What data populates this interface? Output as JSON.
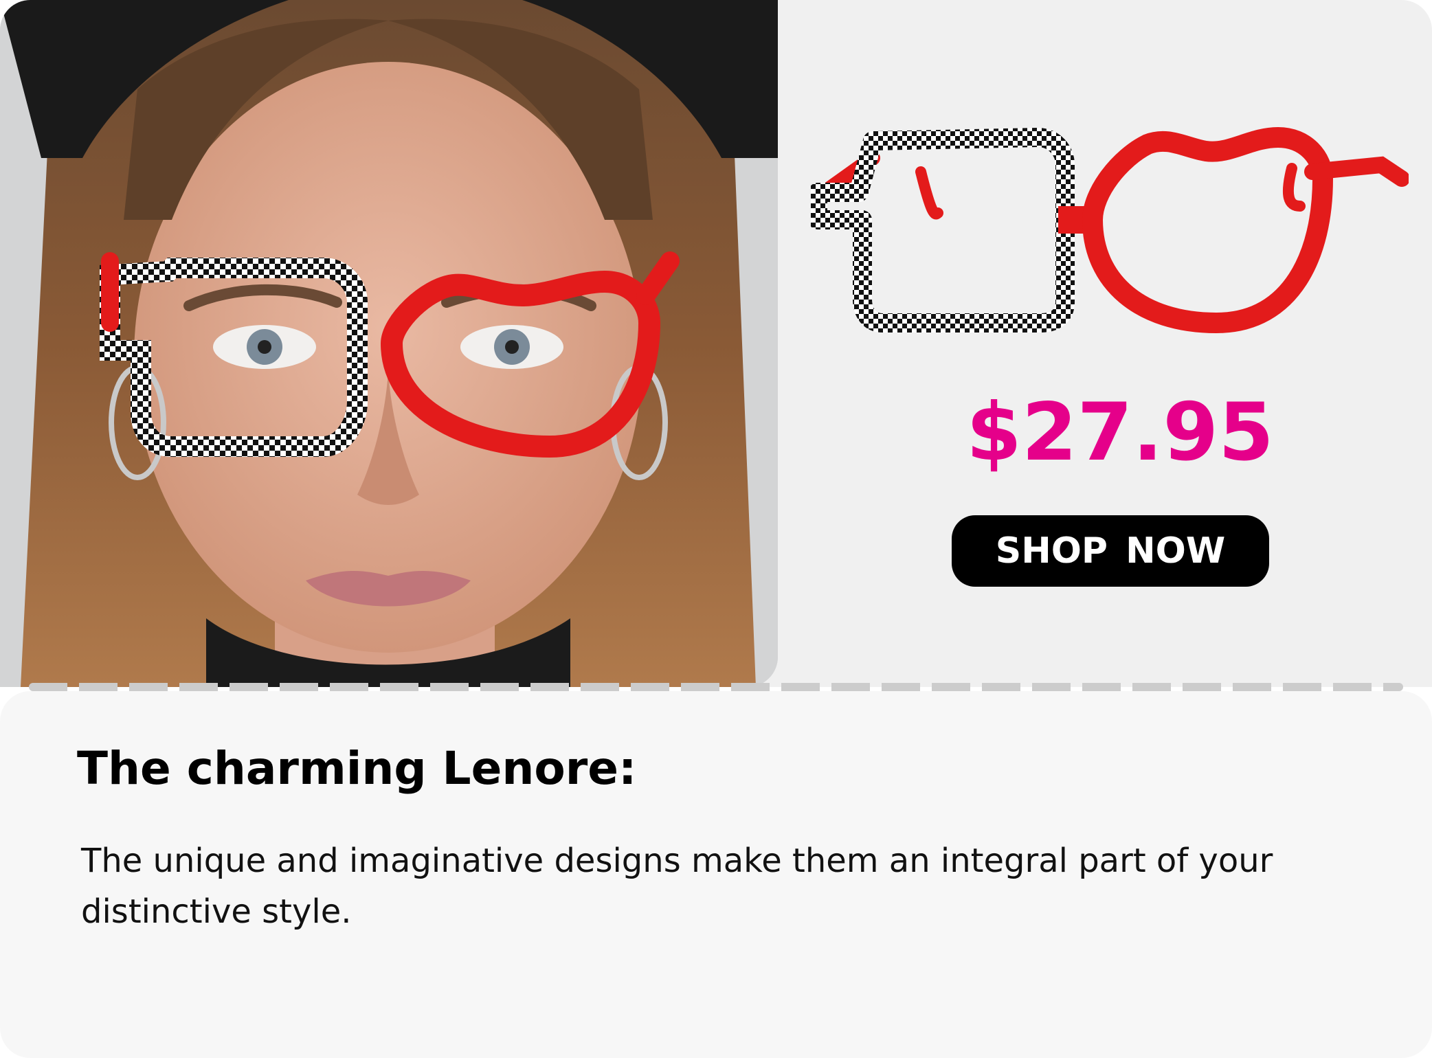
{
  "product": {
    "price": "$27.95",
    "shop_button_label": "SHOP  NOW",
    "headline": "The charming Lenore:",
    "description": "The unique and imaginative designs make them an integral part of your distinctive style."
  },
  "colors": {
    "price": "#e5008a",
    "frame_red": "#e31b1b",
    "button": "#000000",
    "divider": "#cccccc"
  },
  "images": {
    "model_photo": "woman-wearing-checkered-red-glasses",
    "product_photo": "checkered-red-eyeglasses"
  }
}
